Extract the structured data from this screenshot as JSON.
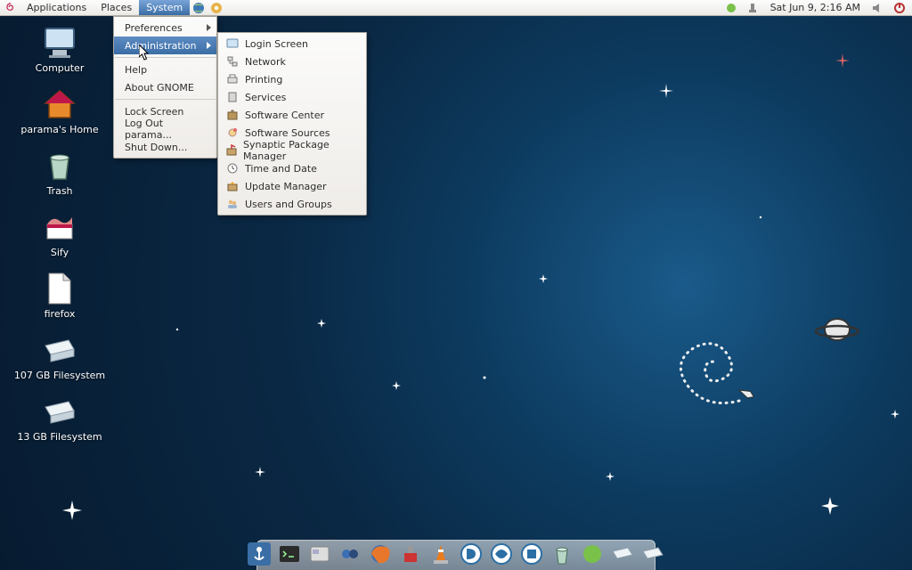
{
  "panel": {
    "apps": "Applications",
    "places": "Places",
    "system": "System",
    "clock": "Sat Jun  9,  2:16 AM"
  },
  "system_menu": {
    "preferences": "Preferences",
    "administration": "Administration",
    "help": "Help",
    "about": "About GNOME",
    "lock": "Lock Screen",
    "logout": "Log Out parama...",
    "shutdown": "Shut Down..."
  },
  "admin_menu": {
    "items": [
      "Login Screen",
      "Network",
      "Printing",
      "Services",
      "Software Center",
      "Software Sources",
      "Synaptic Package Manager",
      "Time and Date",
      "Update Manager",
      "Users and Groups"
    ]
  },
  "desktop_icons": [
    {
      "label": "Computer",
      "icon": "computer"
    },
    {
      "label": "parama's Home",
      "icon": "home"
    },
    {
      "label": "Trash",
      "icon": "trash"
    },
    {
      "label": "Sify",
      "icon": "sify"
    },
    {
      "label": "firefox",
      "icon": "file"
    },
    {
      "label": "107 GB Filesystem",
      "icon": "drive"
    },
    {
      "label": "13 GB Filesystem",
      "icon": "drive"
    }
  ],
  "dock": [
    "anchor",
    "terminal",
    "files",
    "paint",
    "firefox",
    "transmission",
    "vlc",
    "ooo-writer",
    "ooo-calc",
    "ooo-impress",
    "trash",
    "home",
    "drive1",
    "drive2"
  ]
}
